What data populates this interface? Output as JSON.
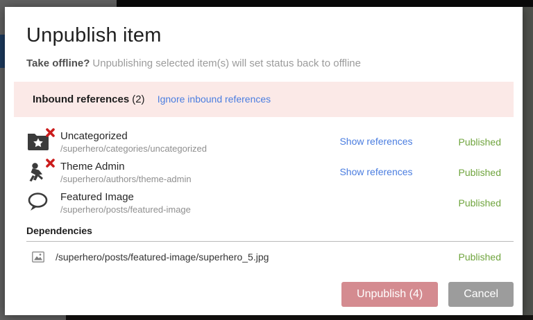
{
  "modal": {
    "title": "Unpublish item",
    "subtitle_bold": "Take offline?",
    "subtitle_rest": "Unpublishing selected item(s) will set status back to offline",
    "banner": {
      "label": "Inbound references",
      "count": "(2)",
      "link": "Ignore inbound references"
    },
    "references": [
      {
        "name": "Uncategorized",
        "path": "/superhero/categories/uncategorized",
        "icon": "folder-star-icon",
        "delete_marked": true,
        "link": "Show references",
        "status": "Published"
      },
      {
        "name": "Theme Admin",
        "path": "/superhero/authors/theme-admin",
        "icon": "superhero-icon",
        "delete_marked": true,
        "link": "Show references",
        "status": "Published"
      },
      {
        "name": "Featured Image",
        "path": "/superhero/posts/featured-image",
        "icon": "comment-icon",
        "delete_marked": false,
        "link": "",
        "status": "Published"
      }
    ],
    "dependencies": {
      "heading": "Dependencies",
      "items": [
        {
          "path": "/superhero/posts/featured-image/superhero_5.jpg",
          "icon": "image-icon",
          "status": "Published"
        }
      ]
    },
    "buttons": {
      "unpublish": "Unpublish (4)",
      "cancel": "Cancel"
    },
    "colors": {
      "banner_pink": "#fbe9e7",
      "link_blue": "#4a7de0",
      "status_green": "#6fa43d",
      "unpublish_bg": "#d48b90",
      "cancel_bg": "#9c9c9c",
      "delete_mark_red": "#cb1c1c"
    }
  }
}
